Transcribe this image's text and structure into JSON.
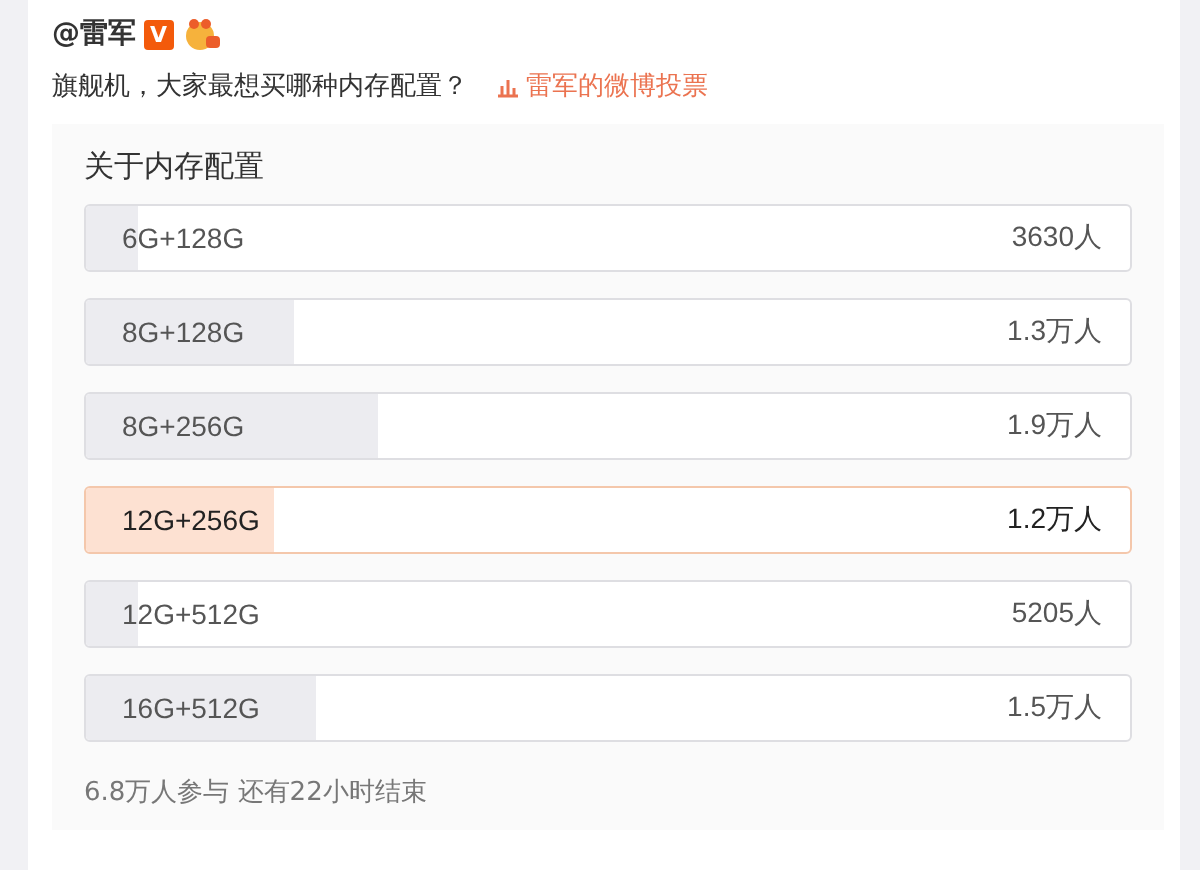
{
  "post": {
    "author": "@雷军",
    "verified_badge": "V",
    "question": "旗舰机，大家最想买哪种内存配置？",
    "poll_link": "雷军的微博投票"
  },
  "poll": {
    "title": "关于内存配置",
    "options": [
      {
        "label": "6G+128G",
        "count": "3630人",
        "level": 0.05,
        "selected": false
      },
      {
        "label": "8G+128G",
        "count": "1.3万人",
        "level": 0.2,
        "selected": false
      },
      {
        "label": "8G+256G",
        "count": "1.9万人",
        "level": 0.28,
        "selected": false
      },
      {
        "label": "12G+256G",
        "count": "1.2万人",
        "level": 0.18,
        "selected": true
      },
      {
        "label": "12G+512G",
        "count": "5205人",
        "level": 0.05,
        "selected": false
      },
      {
        "label": "16G+512G",
        "count": "1.5万人",
        "level": 0.22,
        "selected": false
      }
    ],
    "footer": "6.8万人参与 还有22小时结束"
  }
}
